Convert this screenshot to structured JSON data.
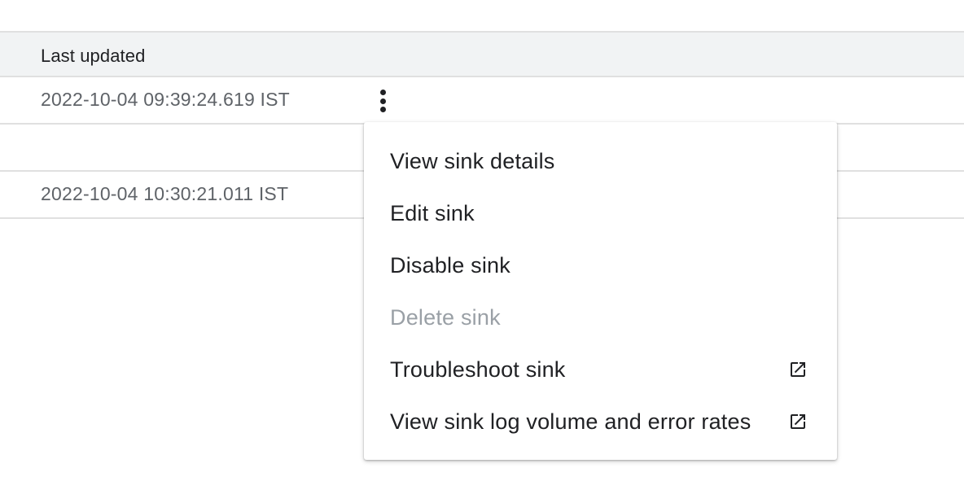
{
  "table": {
    "header": {
      "last_updated": "Last updated"
    },
    "rows": [
      {
        "last_updated": "2022-10-04 09:39:24.619 IST"
      },
      {
        "last_updated": ""
      },
      {
        "last_updated": "2022-10-04 10:30:21.011 IST"
      }
    ]
  },
  "menu": {
    "items": [
      {
        "label": "View sink details",
        "enabled": true,
        "external": false
      },
      {
        "label": "Edit sink",
        "enabled": true,
        "external": false
      },
      {
        "label": "Disable sink",
        "enabled": true,
        "external": false
      },
      {
        "label": "Delete sink",
        "enabled": false,
        "external": false
      },
      {
        "label": "Troubleshoot sink",
        "enabled": true,
        "external": true,
        "icon": "open-in-new-icon"
      },
      {
        "label": "View sink log volume and error rates",
        "enabled": true,
        "external": true,
        "icon": "open-in-new-icon"
      }
    ]
  },
  "icons": {
    "row_actions": "more-vert-icon",
    "external_link": "open-in-new-icon"
  },
  "colors": {
    "header_bg": "#f1f3f4",
    "divider": "#e0e0e0",
    "primary_text": "#202124",
    "secondary_text": "#5f6368",
    "disabled_text": "#9aa0a6"
  }
}
